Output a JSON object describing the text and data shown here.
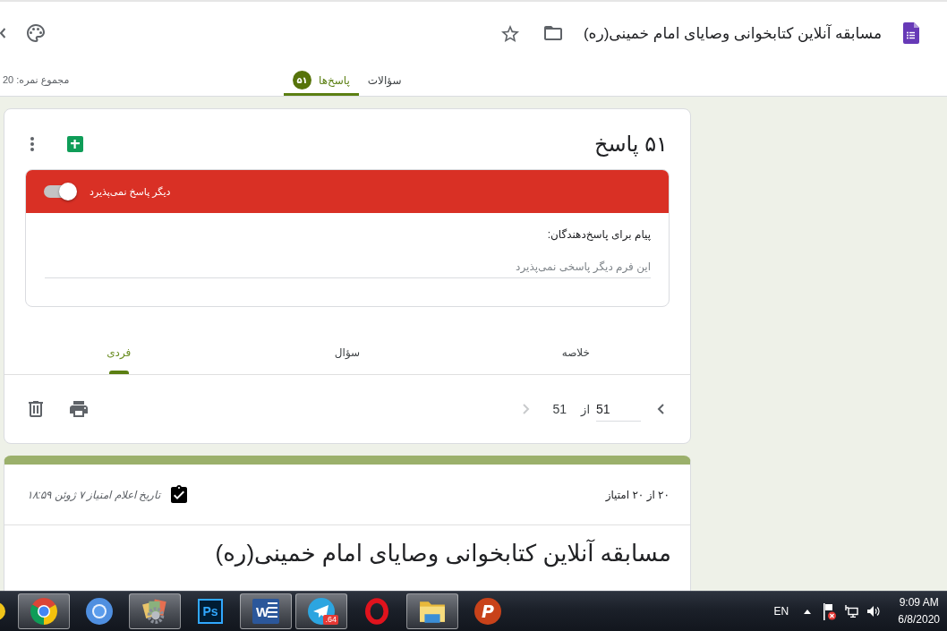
{
  "header": {
    "title": "مسابقه آنلاین کتابخوانی وصایای امام خمینی(ره)",
    "tabs": [
      {
        "label": "سؤالات",
        "selected": false
      },
      {
        "label": "پاسخ‌ها",
        "badge": "۵۱",
        "selected": true
      }
    ],
    "total_points": "مجموع نمره: 20"
  },
  "responses_card": {
    "title": "۵۱ پاسخ",
    "accepting": {
      "label": "دیگر پاسخ نمی‌پذیرد",
      "on": false
    },
    "message": {
      "label": "پیام برای پاسخ‌دهندگان:",
      "placeholder": "این فرم دیگر پاسخی نمی‌پذیرد"
    },
    "view_tabs": [
      {
        "label": "خلاصه",
        "selected": false
      },
      {
        "label": "سؤال",
        "selected": false
      },
      {
        "label": "فردی",
        "selected": true
      }
    ],
    "pager": {
      "value": "51",
      "separator": "از",
      "total": "51",
      "buttons": [
        {
          "disabled": false
        },
        {
          "disabled": true
        }
      ]
    }
  },
  "response": {
    "score": "۲۰ از ۲۰ امتیاز",
    "release_note": "تاریخ اعلام امتیاز ۷ ژوئن ۱۸:۵۹",
    "form_title": "مسابقه آنلاین کتابخوانی وصایای امام خمینی(ره)"
  },
  "taskbar": {
    "apps": [
      {
        "kind": "disc",
        "label": "P",
        "highlighted": false
      },
      {
        "kind": "folder",
        "highlighted": true
      },
      {
        "kind": "oval",
        "highlighted": false
      },
      {
        "kind": "plane",
        "badge": ".64",
        "highlighted": true
      },
      {
        "kind": "document",
        "label": "W",
        "highlighted": true
      },
      {
        "kind": "tile",
        "label": "Ps",
        "highlighted": false
      },
      {
        "kind": "gears",
        "highlighted": true
      },
      {
        "kind": "circle",
        "highlighted": false
      },
      {
        "kind": "ring",
        "highlighted": true
      }
    ],
    "language": "EN",
    "time": "9:09 AM",
    "date": "6/8/2020"
  }
}
